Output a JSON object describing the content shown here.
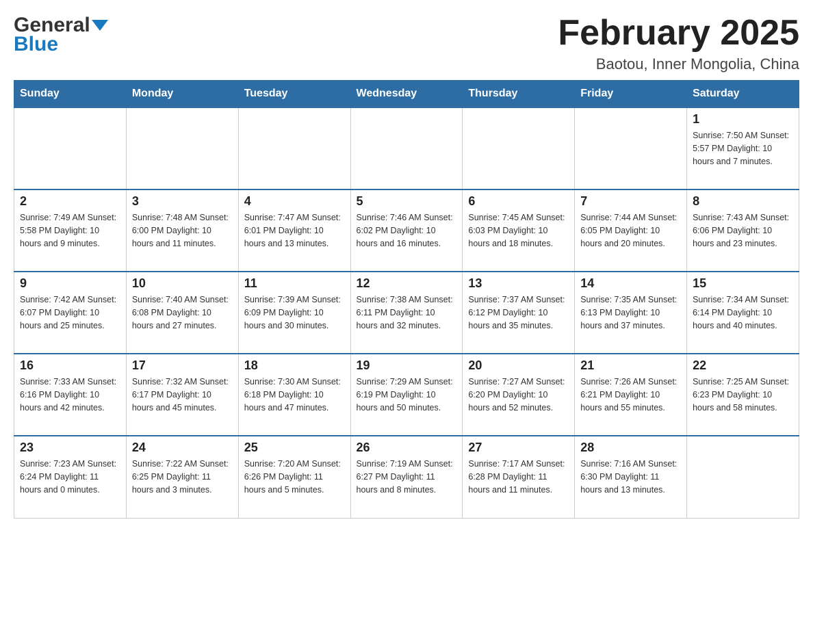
{
  "header": {
    "logo_general": "General",
    "logo_blue": "Blue",
    "month_title": "February 2025",
    "location": "Baotou, Inner Mongolia, China"
  },
  "days_of_week": [
    "Sunday",
    "Monday",
    "Tuesday",
    "Wednesday",
    "Thursday",
    "Friday",
    "Saturday"
  ],
  "weeks": [
    {
      "days": [
        {
          "date": "",
          "info": ""
        },
        {
          "date": "",
          "info": ""
        },
        {
          "date": "",
          "info": ""
        },
        {
          "date": "",
          "info": ""
        },
        {
          "date": "",
          "info": ""
        },
        {
          "date": "",
          "info": ""
        },
        {
          "date": "1",
          "info": "Sunrise: 7:50 AM\nSunset: 5:57 PM\nDaylight: 10 hours and 7 minutes."
        }
      ]
    },
    {
      "days": [
        {
          "date": "2",
          "info": "Sunrise: 7:49 AM\nSunset: 5:58 PM\nDaylight: 10 hours and 9 minutes."
        },
        {
          "date": "3",
          "info": "Sunrise: 7:48 AM\nSunset: 6:00 PM\nDaylight: 10 hours and 11 minutes."
        },
        {
          "date": "4",
          "info": "Sunrise: 7:47 AM\nSunset: 6:01 PM\nDaylight: 10 hours and 13 minutes."
        },
        {
          "date": "5",
          "info": "Sunrise: 7:46 AM\nSunset: 6:02 PM\nDaylight: 10 hours and 16 minutes."
        },
        {
          "date": "6",
          "info": "Sunrise: 7:45 AM\nSunset: 6:03 PM\nDaylight: 10 hours and 18 minutes."
        },
        {
          "date": "7",
          "info": "Sunrise: 7:44 AM\nSunset: 6:05 PM\nDaylight: 10 hours and 20 minutes."
        },
        {
          "date": "8",
          "info": "Sunrise: 7:43 AM\nSunset: 6:06 PM\nDaylight: 10 hours and 23 minutes."
        }
      ]
    },
    {
      "days": [
        {
          "date": "9",
          "info": "Sunrise: 7:42 AM\nSunset: 6:07 PM\nDaylight: 10 hours and 25 minutes."
        },
        {
          "date": "10",
          "info": "Sunrise: 7:40 AM\nSunset: 6:08 PM\nDaylight: 10 hours and 27 minutes."
        },
        {
          "date": "11",
          "info": "Sunrise: 7:39 AM\nSunset: 6:09 PM\nDaylight: 10 hours and 30 minutes."
        },
        {
          "date": "12",
          "info": "Sunrise: 7:38 AM\nSunset: 6:11 PM\nDaylight: 10 hours and 32 minutes."
        },
        {
          "date": "13",
          "info": "Sunrise: 7:37 AM\nSunset: 6:12 PM\nDaylight: 10 hours and 35 minutes."
        },
        {
          "date": "14",
          "info": "Sunrise: 7:35 AM\nSunset: 6:13 PM\nDaylight: 10 hours and 37 minutes."
        },
        {
          "date": "15",
          "info": "Sunrise: 7:34 AM\nSunset: 6:14 PM\nDaylight: 10 hours and 40 minutes."
        }
      ]
    },
    {
      "days": [
        {
          "date": "16",
          "info": "Sunrise: 7:33 AM\nSunset: 6:16 PM\nDaylight: 10 hours and 42 minutes."
        },
        {
          "date": "17",
          "info": "Sunrise: 7:32 AM\nSunset: 6:17 PM\nDaylight: 10 hours and 45 minutes."
        },
        {
          "date": "18",
          "info": "Sunrise: 7:30 AM\nSunset: 6:18 PM\nDaylight: 10 hours and 47 minutes."
        },
        {
          "date": "19",
          "info": "Sunrise: 7:29 AM\nSunset: 6:19 PM\nDaylight: 10 hours and 50 minutes."
        },
        {
          "date": "20",
          "info": "Sunrise: 7:27 AM\nSunset: 6:20 PM\nDaylight: 10 hours and 52 minutes."
        },
        {
          "date": "21",
          "info": "Sunrise: 7:26 AM\nSunset: 6:21 PM\nDaylight: 10 hours and 55 minutes."
        },
        {
          "date": "22",
          "info": "Sunrise: 7:25 AM\nSunset: 6:23 PM\nDaylight: 10 hours and 58 minutes."
        }
      ]
    },
    {
      "days": [
        {
          "date": "23",
          "info": "Sunrise: 7:23 AM\nSunset: 6:24 PM\nDaylight: 11 hours and 0 minutes."
        },
        {
          "date": "24",
          "info": "Sunrise: 7:22 AM\nSunset: 6:25 PM\nDaylight: 11 hours and 3 minutes."
        },
        {
          "date": "25",
          "info": "Sunrise: 7:20 AM\nSunset: 6:26 PM\nDaylight: 11 hours and 5 minutes."
        },
        {
          "date": "26",
          "info": "Sunrise: 7:19 AM\nSunset: 6:27 PM\nDaylight: 11 hours and 8 minutes."
        },
        {
          "date": "27",
          "info": "Sunrise: 7:17 AM\nSunset: 6:28 PM\nDaylight: 11 hours and 11 minutes."
        },
        {
          "date": "28",
          "info": "Sunrise: 7:16 AM\nSunset: 6:30 PM\nDaylight: 11 hours and 13 minutes."
        },
        {
          "date": "",
          "info": ""
        }
      ]
    }
  ]
}
